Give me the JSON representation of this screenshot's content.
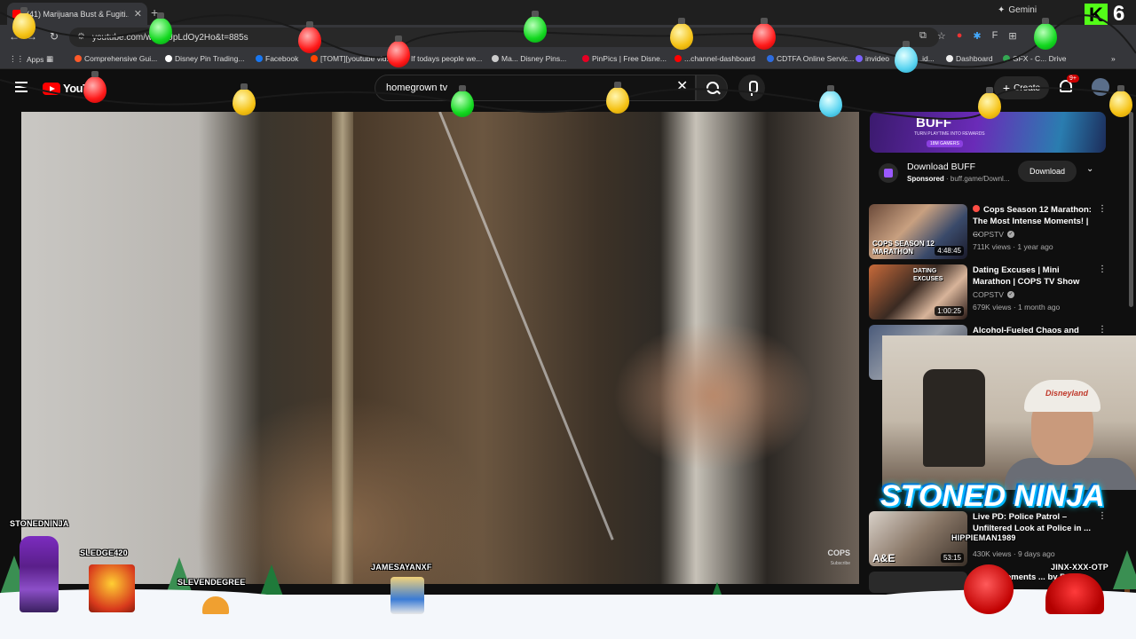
{
  "browser": {
    "tab_title": "(41) Marijuana Bust & Fugiti...",
    "url": "youtube.com/w    =ccJpLdOy2Ho&t=885s",
    "gemini_label": "Gemini",
    "apps_label": "Apps",
    "bookmarks": [
      {
        "label": "Comprehensive Gui...",
        "color": "#ff5a2a"
      },
      {
        "label": "Disney Pin Trading...",
        "color": "#ffffff"
      },
      {
        "label": "Facebook",
        "color": "#1877f2"
      },
      {
        "label": "[TOMT][youtube vid...",
        "color": "#ff4500"
      },
      {
        "label": "If todays people we...",
        "color": "#aaaaaa"
      },
      {
        "label": "Ma...  Disney Pins...",
        "color": "#cccccc"
      },
      {
        "label": "PinPics | Free Disne...",
        "color": "#e60023"
      },
      {
        "label": "...channel-dashboard",
        "color": "#ff0000"
      },
      {
        "label": "CDTFA Online Servic...",
        "color": "#2d6cdf"
      },
      {
        "label": "invideo",
        "color": "#7b61ff"
      },
      {
        "label": "...id...",
        "color": "#aaaaaa"
      },
      {
        "label": "Dashboard",
        "color": "#eeeeee"
      },
      {
        "label": "GFX - C...  Drive",
        "color": "#34a853"
      }
    ],
    "kick_count": "6"
  },
  "youtube": {
    "logo_text": "YouT",
    "search_value": "homegrown tv",
    "create_label": "Create",
    "notif_count": "9+",
    "watermark": "COPS",
    "watermark_sub": "Subscribe"
  },
  "ad": {
    "banner_brand": "BUFF",
    "banner_tag": "TURN PLAYTIME INTO REWARDS",
    "banner_pill": "18M GAMERS",
    "title": "Download BUFF",
    "sponsored": "Sponsored",
    "domain": "· buff.game/Downl...",
    "button": "Download"
  },
  "recommendations": [
    {
      "title": "Cops Season 12 Marathon: The Most Intense Moments! | ...",
      "channel": "COPSTV",
      "views": "711K views · 1 year ago",
      "duration": "4:48:45",
      "thumb_label": "COPS SEASON 12 MARATHON",
      "live_dot": true
    },
    {
      "title": "Dating Excuses | Mini Marathon | COPS TV Show",
      "channel": "COPSTV",
      "views": "679K views · 1 month ago",
      "duration": "1:00:25",
      "thumb_label": "DATING EXCUSES",
      "live_dot": false
    },
    {
      "title": "Alcohol-Fueled Chaos and",
      "channel": "",
      "views": "",
      "duration": "",
      "thumb_label": "",
      "live_dot": false
    },
    {
      "title": "Live PD: Police Patrol – Unfiltered Look at Police in ...",
      "channel": "",
      "views": "430K views · 9 days ago",
      "duration": "53:15",
      "thumb_label": "A&E",
      "live_dot": false
    },
    {
      "title": "COPS Moments ... by Police",
      "channel": "",
      "views": "",
      "duration": "",
      "thumb_label": "",
      "live_dot": false
    }
  ],
  "overlay": {
    "brand": "STONED NINJA",
    "chatters": [
      "STONEDNINJA",
      "SLEDGE420",
      "SLEVENDEGREE",
      "JAMESAYANXF",
      "HIPPIEMAN1989",
      "JINX-XXX-OTP"
    ]
  },
  "colors": {
    "youtube_red": "#ff0000",
    "kick_green": "#53fc18",
    "bulb_yellow": "#f5c215",
    "bulb_green": "#12d81f",
    "bulb_red": "#ff1a1a",
    "bulb_blue": "#5ad4f0"
  }
}
